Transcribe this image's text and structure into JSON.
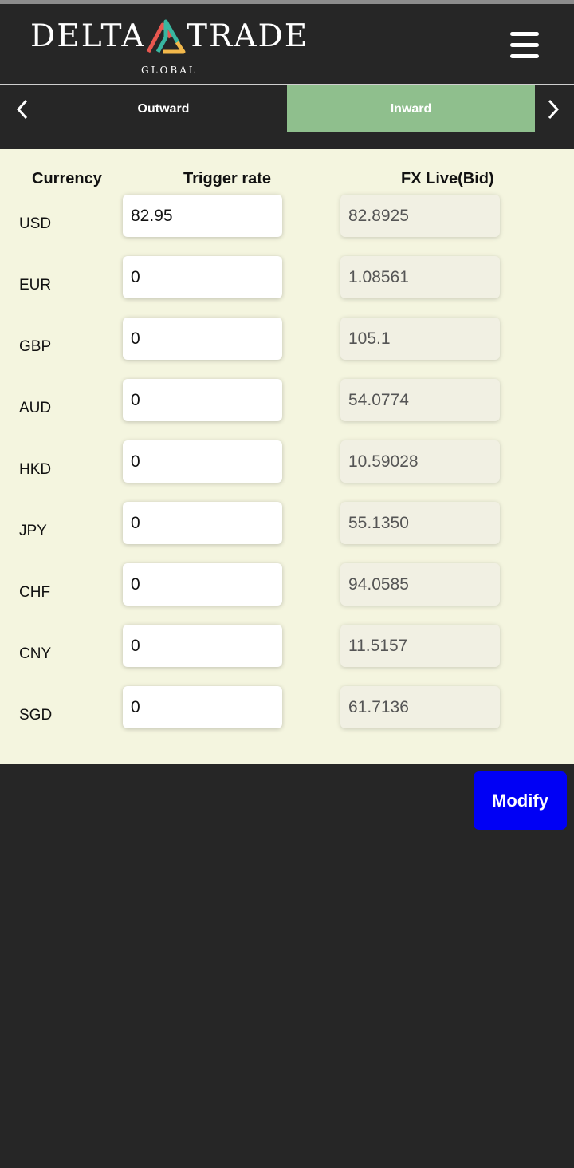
{
  "brand": {
    "name_left": "DELTA",
    "name_right": "TRADE",
    "subtitle": "GLOBAL",
    "logo_colors": [
      "#e8574f",
      "#38b7a0",
      "#f2b84b"
    ]
  },
  "menu": {
    "icon": "hamburger-menu-icon"
  },
  "tabs": [
    {
      "label": "Outward",
      "active": false
    },
    {
      "label": "Inward",
      "active": true
    }
  ],
  "nav": {
    "prev_icon": "chevron-left-icon",
    "next_icon": "chevron-right-icon"
  },
  "table": {
    "headers": {
      "currency": "Currency",
      "trigger": "Trigger rate",
      "fx": "FX Live(Bid)"
    },
    "rows": [
      {
        "currency": "USD",
        "trigger": "82.95",
        "fx": "82.8925"
      },
      {
        "currency": "EUR",
        "trigger": "0",
        "fx": "1.08561"
      },
      {
        "currency": "GBP",
        "trigger": "0",
        "fx": "105.1"
      },
      {
        "currency": "AUD",
        "trigger": "0",
        "fx": "54.0774"
      },
      {
        "currency": "HKD",
        "trigger": "0",
        "fx": "10.59028"
      },
      {
        "currency": "JPY",
        "trigger": "0",
        "fx": "55.1350"
      },
      {
        "currency": "CHF",
        "trigger": "0",
        "fx": "94.0585"
      },
      {
        "currency": "CNY",
        "trigger": "0",
        "fx": "11.5157"
      },
      {
        "currency": "SGD",
        "trigger": "0",
        "fx": "61.7136"
      }
    ]
  },
  "actions": {
    "modify_label": "Modify"
  },
  "colors": {
    "background": "#262626",
    "panel": "#f4f5df",
    "active_tab": "#8fbf8d",
    "modify_button": "#0000f5"
  }
}
